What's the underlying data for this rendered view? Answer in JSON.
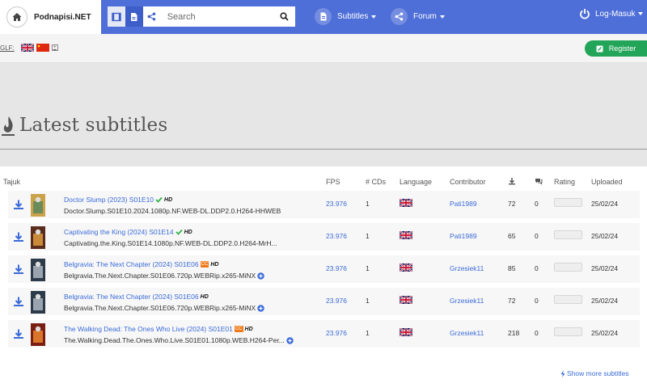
{
  "header": {
    "brand": "Podnapisi.NET",
    "search_placeholder": "Search",
    "menu_subtitles": "Subtitles",
    "menu_forum": "Forum",
    "user_label": "Log-Masuk",
    "accent_color": "#4e6ed8"
  },
  "subbar": {
    "glf_label": "GLF:",
    "plus_symbol": "+",
    "register_label": "Register"
  },
  "page": {
    "title": "Latest subtitles"
  },
  "table": {
    "columns": {
      "name": "Tajuk",
      "fps": "FPS",
      "cds": "# CDs",
      "language": "Language",
      "contributor": "Contributor",
      "uploaded": "Uploaded"
    },
    "rows": [
      {
        "title": "Doctor Slump (2023) S01E10",
        "release": "Doctor.Slump.S01E10.2024.1080p.NF.WEB-DL.DDP2.0.H264-HHWEB",
        "badge_check": true,
        "badge_cc": false,
        "hd": "HD",
        "expand": false,
        "fps": "23.976",
        "cds": "1",
        "contributor": "Pati1989",
        "downloads": "72",
        "comments": "0",
        "uploaded": "25/02/24",
        "poster_colors": [
          "#c9a24a",
          "#6b8c5a"
        ]
      },
      {
        "title": "Captivating the King (2024) S01E14",
        "release": "Captivating.the.King.S01E14.1080p.NF.WEB-DL.DDP2.0.H264-MrH...",
        "badge_check": true,
        "badge_cc": false,
        "hd": "HD",
        "expand": false,
        "fps": "23.976",
        "cds": "1",
        "contributor": "Pati1989",
        "downloads": "65",
        "comments": "0",
        "uploaded": "25/02/24",
        "poster_colors": [
          "#5a2c1c",
          "#c98a3a"
        ]
      },
      {
        "title": "Belgravia: The Next Chapter (2024) S01E06",
        "release": "Belgravia.The.Next.Chapter.S01E06.720p.WEBRip.x265-MiNX",
        "badge_check": false,
        "badge_cc": true,
        "cc": "CC",
        "hd": "HD",
        "expand": true,
        "fps": "23.976",
        "cds": "1",
        "contributor": "Grzesiek11",
        "downloads": "85",
        "comments": "0",
        "uploaded": "25/02/24",
        "poster_colors": [
          "#2c3a4a",
          "#9aa4ae"
        ]
      },
      {
        "title": "Belgravia: The Next Chapter (2024) S01E06",
        "release": "Belgravia.The.Next.Chapter.S01E06.720p.WEBRip.x265-MiNX",
        "badge_check": false,
        "badge_cc": false,
        "hd": "HD",
        "expand": true,
        "fps": "23.976",
        "cds": "1",
        "contributor": "Grzesiek11",
        "downloads": "72",
        "comments": "0",
        "uploaded": "25/02/24",
        "poster_colors": [
          "#2c3a4a",
          "#9aa4ae"
        ]
      },
      {
        "title": "The Walking Dead: The Ones Who Live (2024) S01E01",
        "release": "The.Walking.Dead.The.Ones.Who.Live.S01E01.1080p.WEB.H264-Per...",
        "badge_check": false,
        "badge_cc": true,
        "cc": "CC",
        "hd": "HD",
        "expand": true,
        "fps": "23.976",
        "cds": "1",
        "contributor": "Grzesiek11",
        "downloads": "218",
        "comments": "0",
        "uploaded": "25/02/24",
        "poster_colors": [
          "#7a1e12",
          "#d8752a"
        ]
      }
    ],
    "show_more": "Show more subtitles"
  },
  "colors": {
    "link": "#3b6bd8",
    "register": "#23a559",
    "check": "#2fb344",
    "cc": "#f07a1a"
  }
}
